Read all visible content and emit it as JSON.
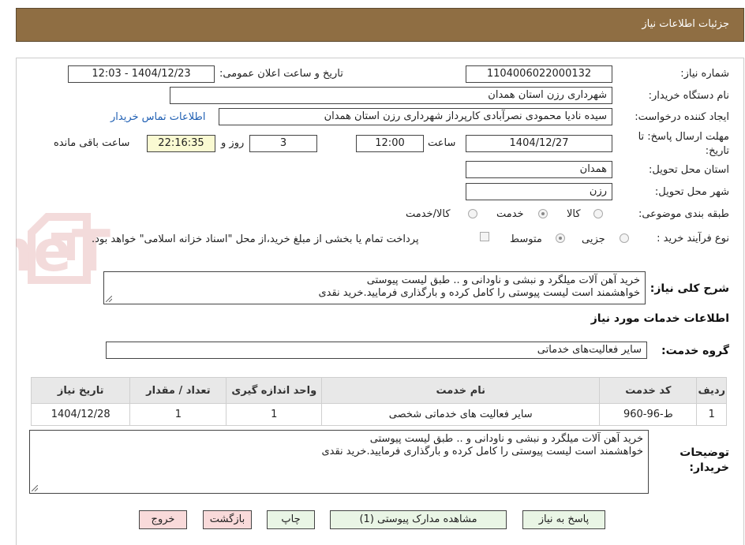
{
  "header": {
    "title": "جزئیات اطلاعات نیاز"
  },
  "form": {
    "need_number_label": "شماره نیاز:",
    "need_number": "1104006022000132",
    "announce_label": "تاریخ و ساعت اعلان عمومی:",
    "announce_value": "1404/12/23 - 12:03",
    "buyer_org_label": "نام دستگاه خریدار:",
    "buyer_org": "شهرداری رزن استان همدان",
    "creator_label": "ایجاد کننده درخواست:",
    "creator": "سیده نادیا محمودی نصرآبادی کارپرداز شهرداری رزن استان همدان",
    "contact_link": "اطلاعات تماس خریدار",
    "deadline_label_1": "مهلت ارسال پاسخ: تا",
    "deadline_label_2": "تاریخ:",
    "deadline_date": "1404/12/27",
    "time_label": "ساعت",
    "deadline_time": "12:00",
    "days_value": "3",
    "days_label": "روز و",
    "remaining_time": "22:16:35",
    "remaining_label": "ساعت باقی مانده",
    "province_label": "استان محل تحویل:",
    "province": "همدان",
    "city_label": "شهر محل تحویل:",
    "city": "رزن",
    "category_label": "طبقه بندی موضوعی:",
    "category_options": [
      "کالا",
      "خدمت",
      "کالا/خدمت"
    ],
    "category_selected": "خدمت",
    "process_label": "نوع فرآیند خرید :",
    "process_options": [
      "جزیی",
      "متوسط"
    ],
    "process_selected": "جزیی",
    "payment_note": "پرداخت تمام یا بخشی از مبلغ خرید،از محل \"اسناد خزانه اسلامی\" خواهد بود.",
    "description_label": "شرح کلی نیاز:",
    "description_line1": "خرید آهن آلات میلگرد و نبشی و ناودانی و .. طبق لیست پیوستی",
    "description_line2": "خواهشمند است لیست پیوستی را کامل کرده و بارگذاری فرمایید.خرید نقدی"
  },
  "services": {
    "section_title": "اطلاعات خدمات مورد نیاز",
    "group_label": "گروه خدمت:",
    "group_value": "سایر فعالیت‌های خدماتی",
    "columns": [
      "ردیف",
      "کد خدمت",
      "نام خدمت",
      "واحد اندازه گیری",
      "تعداد / مقدار",
      "تاریخ نیاز"
    ],
    "rows": [
      [
        "1",
        "ط-96-960",
        "سایر فعالیت های خدماتی شخصی",
        "1",
        "1",
        "1404/12/28"
      ]
    ]
  },
  "buyer_notes": {
    "label_line1": "توضیحات",
    "label_line2": "خریدار:",
    "line1": "خرید آهن آلات میلگرد و نبشی و ناودانی و .. طبق لیست پیوستی",
    "line2": "خواهشمند است لیست پیوستی را کامل کرده و بارگذاری فرمایید.خرید نقدی"
  },
  "buttons": {
    "respond": "پاسخ به نیاز",
    "view_docs": "مشاهده مدارک پیوستی (1)",
    "print": "چاپ",
    "back": "بازگشت",
    "exit": "خروج"
  },
  "watermark": {
    "text": "AriaTender.neT"
  },
  "colors": {
    "header_bg": "#8f6e43",
    "button_green": "#e9f5e5",
    "button_pink": "#f9dada",
    "timer_bg": "#fafad2",
    "link": "#1f5fb3"
  }
}
